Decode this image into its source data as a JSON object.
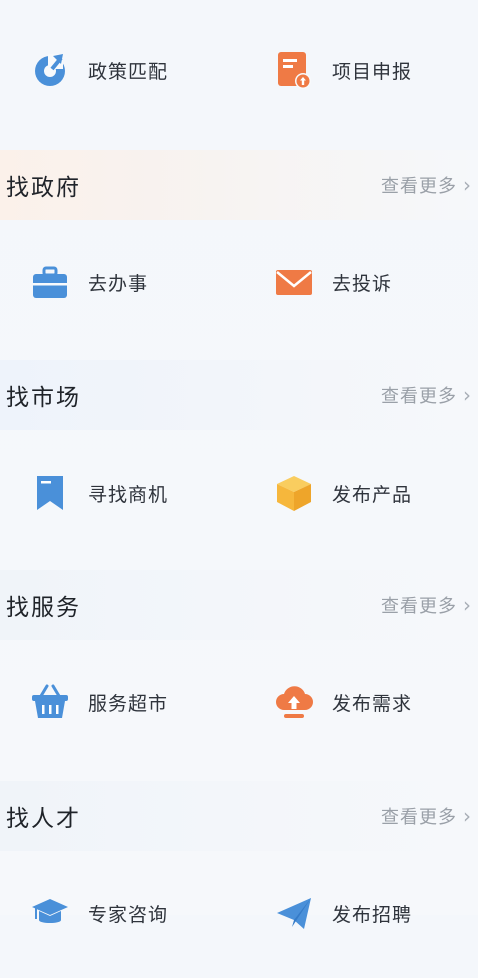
{
  "top_row": {
    "left_label": "政策匹配",
    "right_label": "项目申报"
  },
  "sections": [
    {
      "title": "找政府",
      "more": "查看更多",
      "items": [
        {
          "label": "去办事"
        },
        {
          "label": "去投诉"
        }
      ]
    },
    {
      "title": "找市场",
      "more": "查看更多",
      "items": [
        {
          "label": "寻找商机"
        },
        {
          "label": "发布产品"
        }
      ]
    },
    {
      "title": "找服务",
      "more": "查看更多",
      "items": [
        {
          "label": "服务超市"
        },
        {
          "label": "发布需求"
        }
      ]
    },
    {
      "title": "找人才",
      "more": "查看更多",
      "items": [
        {
          "label": "专家咨询"
        },
        {
          "label": "发布招聘"
        }
      ]
    }
  ],
  "colors": {
    "blue": "#4a90d9",
    "orange": "#ef7a45",
    "yellow": "#f6b73c"
  }
}
